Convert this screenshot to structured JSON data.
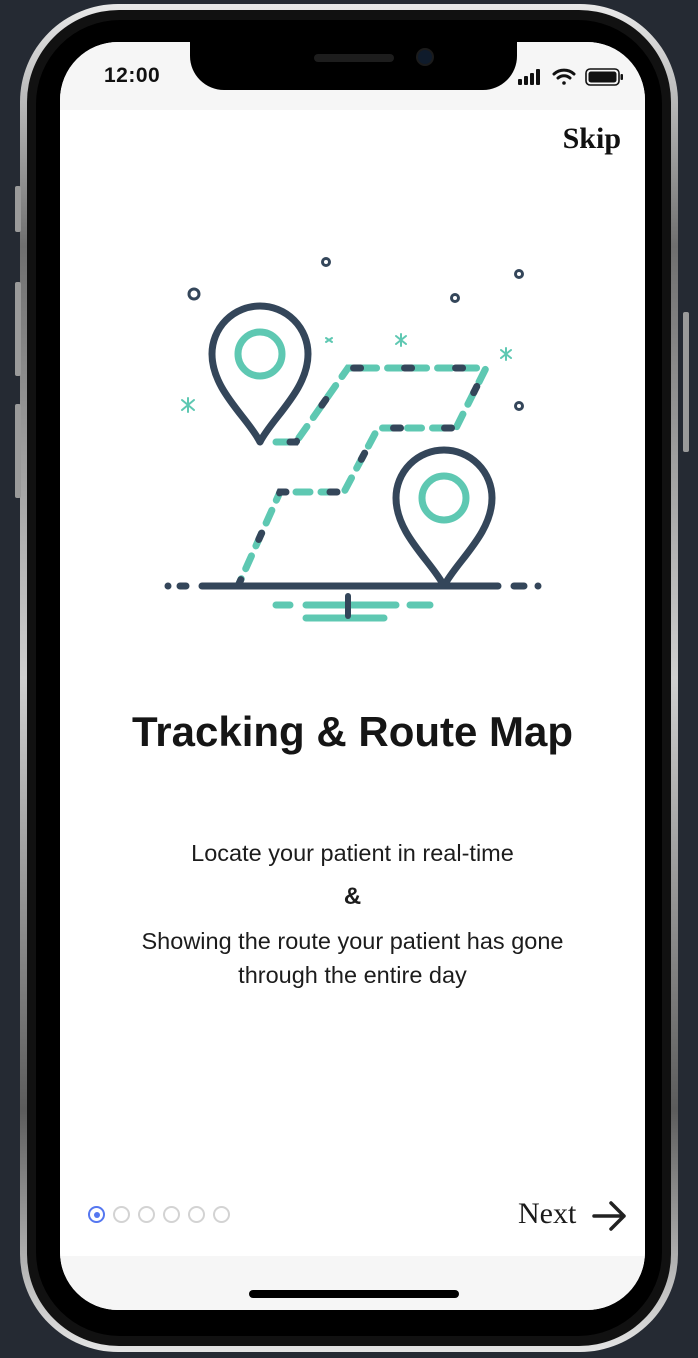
{
  "status_bar": {
    "time": "12:00",
    "icons": [
      "signal-icon",
      "wifi-icon",
      "battery-icon"
    ]
  },
  "header": {
    "skip_label": "Skip"
  },
  "illustration": {
    "icon": "map-route-with-pins-icon",
    "colors": {
      "dark": "#34465a",
      "accent": "#5ec8b2"
    }
  },
  "slide": {
    "title": "Tracking & Route Map",
    "line1": "Locate your patient in real-time",
    "connector": "&",
    "line2": "Showing the route your patient has gone through the entire day"
  },
  "pager": {
    "total": 6,
    "active_index": 0,
    "active_color": "#5577f0",
    "inactive_color": "#d3d3d3"
  },
  "footer": {
    "next_label": "Next",
    "next_icon": "arrow-right-icon"
  }
}
